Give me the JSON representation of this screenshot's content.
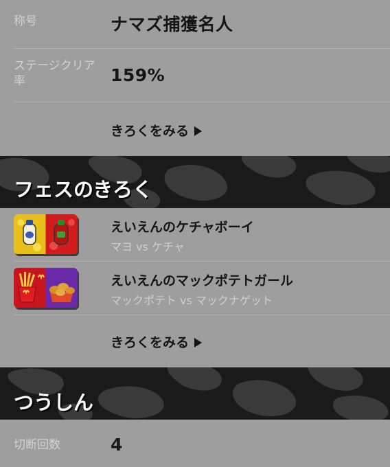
{
  "profile": {
    "title_label": "称号",
    "title_value": "ナマズ捕獲名人",
    "clear_rate_label": "ステージクリア率",
    "clear_rate_value": "159%",
    "records_link": "きろくをみる"
  },
  "fes": {
    "header": "フェスのきろく",
    "items": [
      {
        "name": "えいえんのケチャボーイ",
        "vs": "マヨ vs ケチャ",
        "icon": "mayo-vs-ketchup-icon"
      },
      {
        "name": "えいえんのマックポテトガール",
        "vs": "マックポテト vs マックナゲット",
        "icon": "fries-vs-nuggets-icon"
      }
    ],
    "records_link": "きろくをみる"
  },
  "comms": {
    "header": "つうしん",
    "disconnect_label": "切断回数",
    "disconnect_value": "4"
  },
  "colors": {
    "background": "#9e9e9e",
    "band": "#1a1a1a",
    "mayo_yellow": "#e8c01c",
    "ketchup_red": "#d21c1c",
    "mcd_red": "#c8141e",
    "mcd_purple": "#6a2aa8"
  }
}
